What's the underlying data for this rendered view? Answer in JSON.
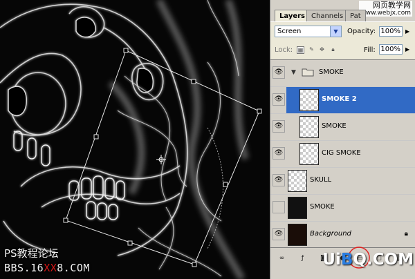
{
  "canvas": {
    "watermark_line1": "PS教程论坛",
    "watermark_line2_a": "BBS.16",
    "watermark_line2_b": "XX",
    "watermark_line2_c": "8.COM"
  },
  "panel": {
    "tabs": [
      "Layers",
      "Channels",
      "Pat"
    ],
    "watermark_top_a": "网页教学网",
    "watermark_top_b": "www.webjx.com",
    "blend_mode": "Screen",
    "opacity_label": "Opacity:",
    "opacity_value": "100%",
    "lock_label": "Lock:",
    "fill_label": "Fill:",
    "fill_value": "100%",
    "layers": [
      {
        "name": "SMOKE",
        "type": "group",
        "visible": true
      },
      {
        "name": "SMOKE 2",
        "type": "layer",
        "visible": true,
        "selected": true
      },
      {
        "name": "SMOKE",
        "type": "layer",
        "visible": true
      },
      {
        "name": "CIG SMOKE",
        "type": "layer",
        "visible": true
      },
      {
        "name": "SKULL",
        "type": "layer",
        "visible": true
      },
      {
        "name": "SMOKE",
        "type": "layer",
        "visible": false
      },
      {
        "name": "Background",
        "type": "layer",
        "visible": true,
        "locked": true
      }
    ],
    "watermark_br_a": "Ui",
    "watermark_br_b": "B",
    "watermark_br_c": "Q",
    "watermark_br_d": ".COM"
  },
  "icons": {
    "eye": "eye-icon",
    "folder": "folder-icon",
    "lock": "lock-icon",
    "dropdown": "chevron-down-icon"
  },
  "colors": {
    "selection": "#316ac5",
    "panel_bg": "#d4d0c8",
    "canvas_bg": "#060606",
    "highlight_circle": "#e02020"
  }
}
